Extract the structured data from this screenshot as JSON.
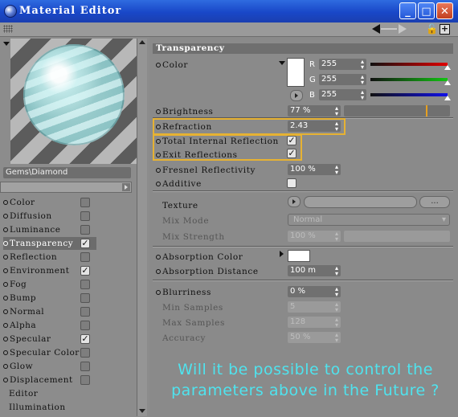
{
  "window": {
    "title": "Material Editor"
  },
  "titlebar": {
    "min": "_",
    "max": "□",
    "close": "✕"
  },
  "toolbar": {
    "lock_glyph": "🔓",
    "plus_glyph": "+"
  },
  "material": {
    "name": "Gems\\Diamond"
  },
  "channels": [
    {
      "label": "Color",
      "checked": false,
      "has_check": true
    },
    {
      "label": "Diffusion",
      "checked": false,
      "has_check": true
    },
    {
      "label": "Luminance",
      "checked": false,
      "has_check": true
    },
    {
      "label": "Transparency",
      "checked": true,
      "has_check": true,
      "active": true
    },
    {
      "label": "Reflection",
      "checked": false,
      "has_check": true
    },
    {
      "label": "Environment",
      "checked": true,
      "has_check": true
    },
    {
      "label": "Fog",
      "checked": false,
      "has_check": true
    },
    {
      "label": "Bump",
      "checked": false,
      "has_check": true
    },
    {
      "label": "Normal",
      "checked": false,
      "has_check": true
    },
    {
      "label": "Alpha",
      "checked": false,
      "has_check": true
    },
    {
      "label": "Specular",
      "checked": true,
      "has_check": true
    },
    {
      "label": "Specular Color",
      "checked": false,
      "has_check": true
    },
    {
      "label": "Glow",
      "checked": false,
      "has_check": true
    },
    {
      "label": "Displacement",
      "checked": false,
      "has_check": true
    },
    {
      "label": "Editor",
      "has_check": false
    },
    {
      "label": "Illumination",
      "has_check": false
    }
  ],
  "section": {
    "title": "Transparency"
  },
  "color": {
    "label": "Color",
    "r_label": "R",
    "g_label": "G",
    "b_label": "B",
    "r": "255",
    "g": "255",
    "b": "255",
    "swatch": "#ffffff"
  },
  "brightness": {
    "label": "Brightness",
    "value": "77 %",
    "level": 0.77
  },
  "refraction": {
    "label": "Refraction",
    "value": "2.43"
  },
  "total_internal_reflection": {
    "label": "Total Internal Reflection",
    "checked": true
  },
  "exit_reflections": {
    "label": "Exit Reflections",
    "checked": true
  },
  "fresnel": {
    "label": "Fresnel Reflectivity",
    "value": "100 %"
  },
  "additive": {
    "label": "Additive",
    "checked": false
  },
  "texture": {
    "label": "Texture",
    "browse": "..."
  },
  "mix_mode": {
    "label": "Mix Mode",
    "value": "Normal"
  },
  "mix_strength": {
    "label": "Mix Strength",
    "value": "100 %"
  },
  "absorption_color": {
    "label": "Absorption Color",
    "swatch": "#ffffff"
  },
  "absorption_distance": {
    "label": "Absorption Distance",
    "value": "100 m"
  },
  "blurriness": {
    "label": "Blurriness",
    "value": "0 %"
  },
  "min_samples": {
    "label": "Min Samples",
    "value": "5"
  },
  "max_samples": {
    "label": "Max Samples",
    "value": "128"
  },
  "accuracy": {
    "label": "Accuracy",
    "value": "50 %"
  },
  "caption": {
    "line1": "Will it be possible to control the",
    "line2": "parameters above in the Future ?"
  },
  "colors": {
    "highlight": "#e6b233",
    "caption": "#4fe3ee",
    "titlebar": "#1947c8"
  }
}
